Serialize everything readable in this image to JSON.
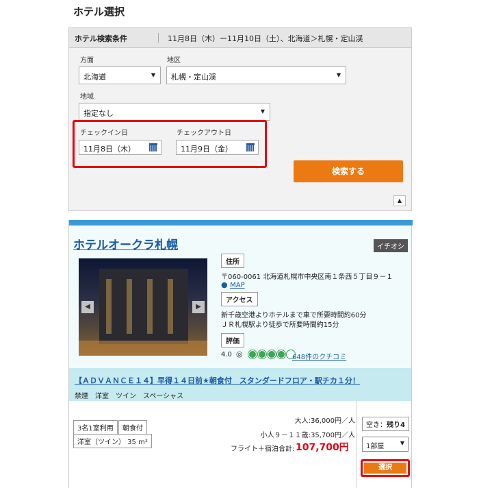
{
  "page": {
    "title": "ホテル選択"
  },
  "search": {
    "title": "ホテル検索条件",
    "summary": "11月8日（木）ー11月10日（土）、北海道＞札幌・定山渓",
    "direction_label": "方面",
    "direction_value": "北海道",
    "district_label": "地区",
    "district_value": "札幌・定山渓",
    "area_label": "地域",
    "area_value": "指定なし",
    "checkin_label": "チェックイン日",
    "checkin_value": "11月8日（木）",
    "checkout_label": "チェックアウト日",
    "checkout_value": "11月9日（金）",
    "search_button": "検索する",
    "collapse_icon": "▲"
  },
  "hotel": {
    "name": "ホテルオークラ札幌",
    "badge": "イチオシ",
    "address_tag": "住所",
    "address": "〒060-0061 北海道札幌市中央区南１条西５丁目９－１",
    "map_link": "MAP",
    "access_tag": "アクセス",
    "access_line1": "新千歳空港よりホテルまで車で所要時間約60分",
    "access_line2": "ＪＲ札幌駅より徒歩で所要時間約15分",
    "rating_tag": "評価",
    "rating_value": "4.0",
    "rating_circles": 4,
    "reviews_link": "648件のクチコミ",
    "photo_prev": "◀",
    "photo_next": "▶"
  },
  "plan": {
    "title": "【ＡＤＶＡＮＣＥ１４】早得１４日前★朝食付　スタンダードフロア・駅チカ１分！",
    "subtitle": "禁煙　洋室　ツイン　スペーシャス",
    "chip_occupancy": "3名1室利用",
    "chip_meal": "朝食付",
    "chip_room": "洋室（ツイン） 35 m²",
    "adult_price": "大人:36,000円／人",
    "child_price": "小人９－１１歳:35,700円／人",
    "total_label": "フライト＋宿泊合計:",
    "total_value": "107,700円",
    "availability_label": "空き：",
    "availability_value": "残り4",
    "rooms_value": "1部屋",
    "select_button": "選択"
  },
  "colors": {
    "accent": "#ec7a13",
    "highlight": "#e60012",
    "link": "#1a5aa6",
    "band": "#c5eaf0"
  }
}
